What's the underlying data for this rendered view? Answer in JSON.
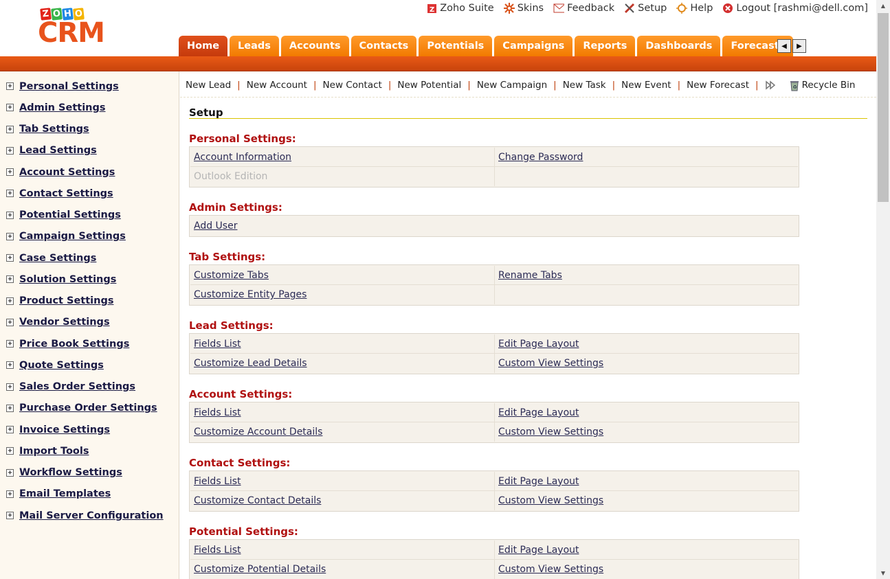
{
  "logo": {
    "zoho_letters": [
      "Z",
      "O",
      "H",
      "O"
    ],
    "zoho_colors": [
      "#e2231a",
      "#3ab54a",
      "#1e88e5",
      "#f4b400"
    ],
    "brand": "CRM"
  },
  "top_links": [
    {
      "label": "Zoho Suite",
      "icon": "zoho-suite-icon"
    },
    {
      "label": "Skins",
      "icon": "skins-icon"
    },
    {
      "label": "Feedback",
      "icon": "feedback-icon"
    },
    {
      "label": "Setup",
      "icon": "setup-icon"
    },
    {
      "label": "Help",
      "icon": "help-icon"
    },
    {
      "label": "Logout [rashmi@dell.com]",
      "icon": "logout-icon"
    }
  ],
  "tabs": [
    {
      "label": "Home",
      "active": true
    },
    {
      "label": "Leads"
    },
    {
      "label": "Accounts"
    },
    {
      "label": "Contacts"
    },
    {
      "label": "Potentials"
    },
    {
      "label": "Campaigns"
    },
    {
      "label": "Reports"
    },
    {
      "label": "Dashboards"
    },
    {
      "label": "Forecasts"
    }
  ],
  "sidebar": {
    "items": [
      "Personal Settings",
      "Admin Settings",
      "Tab Settings",
      "Lead Settings",
      "Account Settings",
      "Contact Settings",
      "Potential Settings",
      "Campaign Settings",
      "Case Settings",
      "Solution Settings",
      "Product Settings",
      "Vendor Settings",
      "Price Book Settings",
      "Quote Settings",
      "Sales Order Settings",
      "Purchase Order Settings",
      "Invoice Settings",
      "Import Tools",
      "Workflow Settings",
      "Email Templates",
      "Mail Server Configuration"
    ]
  },
  "quickbar": {
    "links": [
      "New Lead",
      "New Account",
      "New Contact",
      "New Potential",
      "New Campaign",
      "New Task",
      "New Event",
      "New Forecast"
    ],
    "recycle_bin": "Recycle Bin"
  },
  "main": {
    "title": "Setup",
    "sections": [
      {
        "title": "Personal Settings:",
        "rows": [
          [
            {
              "label": "Account Information"
            },
            {
              "label": "Change Password"
            }
          ],
          [
            {
              "label": "Outlook Edition",
              "disabled": true
            }
          ]
        ]
      },
      {
        "title": "Admin Settings:",
        "rows": [
          [
            {
              "label": "Add User"
            }
          ]
        ],
        "single": true
      },
      {
        "title": "Tab Settings:",
        "rows": [
          [
            {
              "label": "Customize Tabs"
            },
            {
              "label": "Rename Tabs"
            }
          ],
          [
            {
              "label": "Customize Entity Pages"
            },
            {
              "label": ""
            }
          ]
        ]
      },
      {
        "title": "Lead Settings:",
        "rows": [
          [
            {
              "label": "Fields List"
            },
            {
              "label": "Edit Page Layout"
            }
          ],
          [
            {
              "label": "Customize Lead Details"
            },
            {
              "label": "Custom View Settings"
            }
          ]
        ]
      },
      {
        "title": "Account Settings:",
        "rows": [
          [
            {
              "label": "Fields List"
            },
            {
              "label": "Edit Page Layout"
            }
          ],
          [
            {
              "label": "Customize Account Details"
            },
            {
              "label": "Custom View Settings"
            }
          ]
        ]
      },
      {
        "title": "Contact Settings:",
        "rows": [
          [
            {
              "label": "Fields List"
            },
            {
              "label": "Edit Page Layout"
            }
          ],
          [
            {
              "label": "Customize Contact Details"
            },
            {
              "label": "Custom View Settings"
            }
          ]
        ]
      },
      {
        "title": "Potential Settings:",
        "rows": [
          [
            {
              "label": "Fields List"
            },
            {
              "label": "Edit Page Layout"
            }
          ],
          [
            {
              "label": "Customize Potential Details"
            },
            {
              "label": "Custom View Settings"
            }
          ]
        ]
      }
    ]
  },
  "colors": {
    "accent": "#e8531c",
    "tab": "#f27a00",
    "section_title": "#b01010",
    "sidebar_bg": "#fdf8ef"
  }
}
